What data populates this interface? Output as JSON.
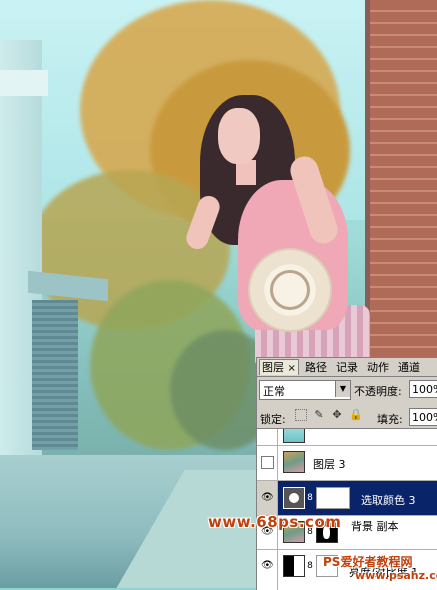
{
  "photo": {
    "subject": "girl-with-hat",
    "tones": {
      "sky": "#c9f2f4",
      "foliage": "#d4a54a",
      "dress": "#f1a8b6",
      "wall": "#b06a58"
    }
  },
  "layers_panel": {
    "tabs": [
      {
        "label": "图层",
        "active": true
      },
      {
        "label": "路径",
        "active": false
      },
      {
        "label": "记录",
        "active": false
      },
      {
        "label": "动作",
        "active": false
      },
      {
        "label": "通道",
        "active": false
      }
    ],
    "tab_close_glyph": "×",
    "blend_mode": "正常",
    "opacity_label": "不透明度:",
    "opacity_value": "100%",
    "lock_label": "锁定:",
    "fill_label": "填充:",
    "fill_value": "100%",
    "layers": [
      {
        "name": "",
        "visible": false,
        "thumb": "teal",
        "selected": false
      },
      {
        "name": "图层 3",
        "visible": false,
        "thumb": "photo",
        "selected": false
      },
      {
        "name": "选取颜色 3",
        "visible": true,
        "thumb": "adjustment",
        "mask": "white",
        "selected": true
      },
      {
        "name": "背景 副本",
        "visible": true,
        "thumb": "photo",
        "mask": "mask",
        "selected": false
      },
      {
        "name": "亮度/对比度 1",
        "visible": true,
        "thumb": "bw",
        "mask": "white",
        "selected": false
      }
    ],
    "selected_color": "#0a246a"
  },
  "watermarks": {
    "site1": "www.68ps.com",
    "site2": "PS爱好者教程网",
    "site3": "www.psahz.com"
  }
}
